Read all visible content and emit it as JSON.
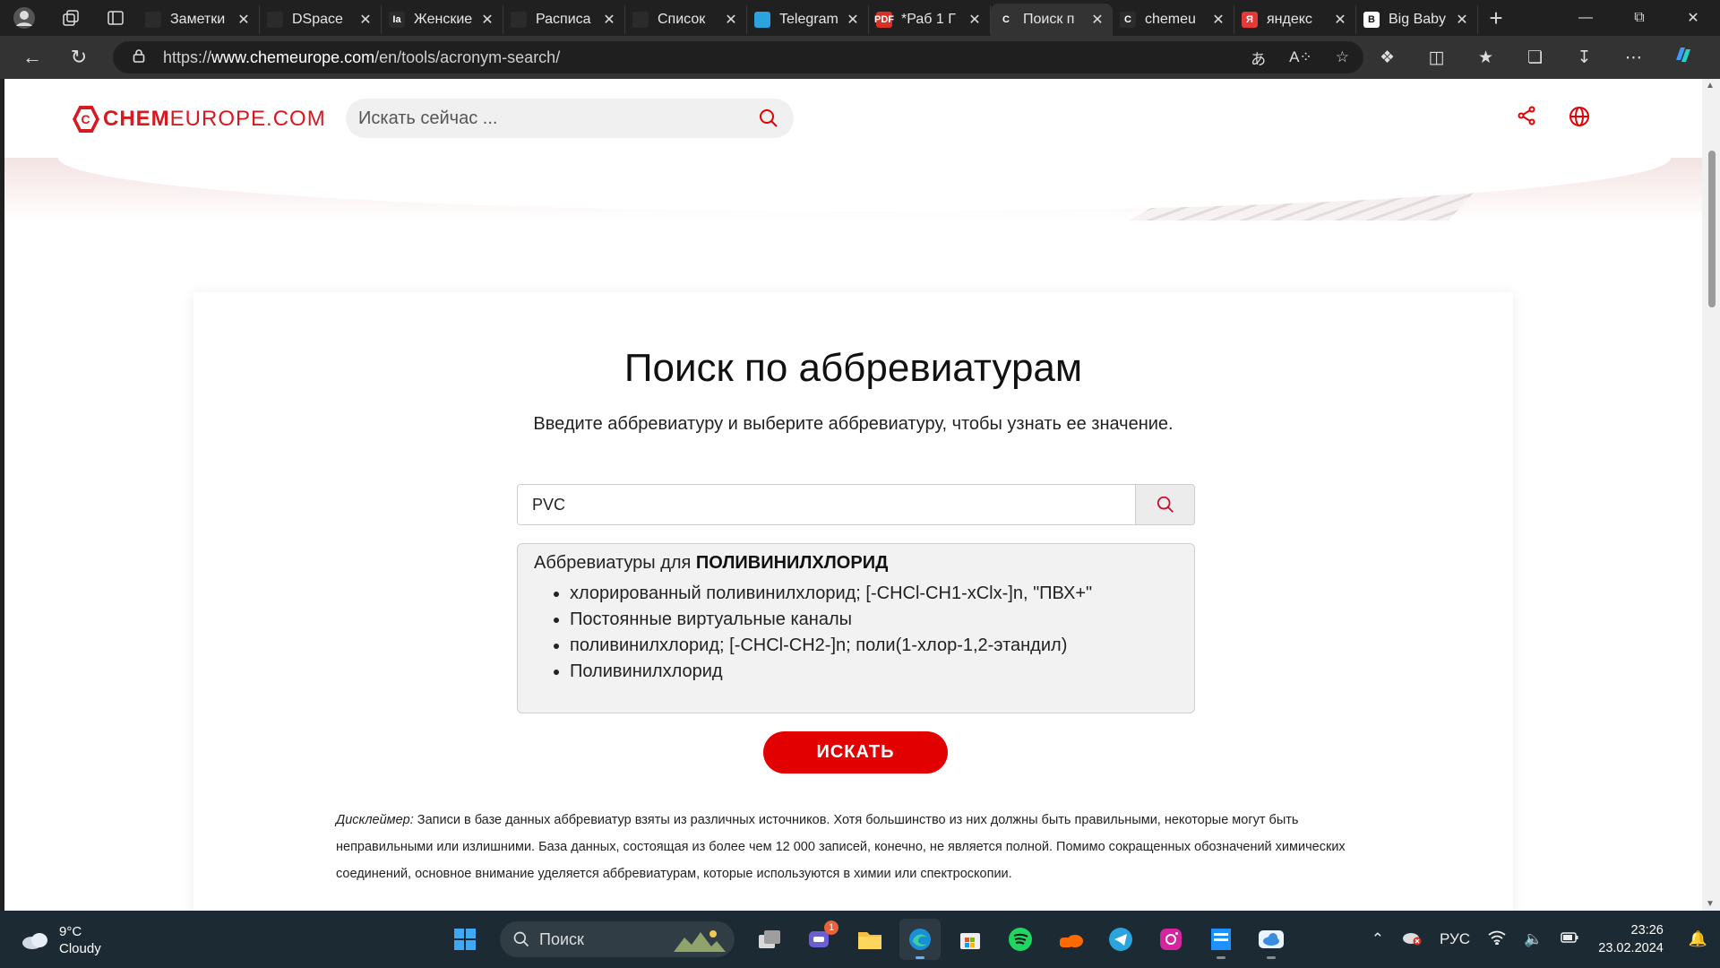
{
  "browser": {
    "tabs": [
      {
        "title": "Заметки",
        "fav_color": "#2b2b2b",
        "fav_glyph": ""
      },
      {
        "title": "DSpace",
        "fav_color": "#2b2b2b",
        "fav_glyph": ""
      },
      {
        "title": "Женские",
        "fav_color": "#2b2b2b",
        "fav_glyph": "Ia"
      },
      {
        "title": "Расписа",
        "fav_color": "#2b2b2b",
        "fav_glyph": ""
      },
      {
        "title": "Список",
        "fav_color": "#2b2b2b",
        "fav_glyph": ""
      },
      {
        "title": "Telegram",
        "fav_color": "#2aa3df",
        "fav_glyph": ""
      },
      {
        "title": "*Раб 1 Г",
        "fav_color": "#d93025",
        "fav_glyph": "PDF"
      },
      {
        "title": "Поиск п",
        "fav_color": "#333333",
        "fav_glyph": "C",
        "active": true
      },
      {
        "title": "chemeu",
        "fav_color": "#2b2b2b",
        "fav_glyph": "C"
      },
      {
        "title": "яндекс",
        "fav_color": "#e53935",
        "fav_glyph": "Я"
      },
      {
        "title": "Big Baby",
        "fav_color": "#ffffff",
        "fav_glyph": "B"
      }
    ],
    "url_prefix": "https://",
    "url_host": "www.chemeurope.com",
    "url_path": "/en/tools/acronym-search/"
  },
  "site": {
    "logo_chem": "CHEM",
    "logo_europe": "EUROPE.COM",
    "search_placeholder": "Искать сейчас ...",
    "accent": "#e20000"
  },
  "main": {
    "title": "Поиск по аббревиатурам",
    "subtitle": "Введите аббревиатуру и выберите аббревиатуру, чтобы узнать ее значение.",
    "query_value": "PVC",
    "result_heading_prefix": "Аббревиатуры для ",
    "result_heading_term": "ПОЛИВИНИЛХЛОРИД",
    "results": [
      "хлорированный поливинилхлорид; [-CHCl-CH1-xClx-]n, \"ПВХ+\"",
      "Постоянные виртуальные каналы",
      "поливинилхлорид; [-CHCl-CH2-]n; поли(1-хлор-1,2-этандил)",
      "Поливинилхлорид"
    ],
    "search_button": "ИСКАТЬ",
    "disclaimer_label": "Дисклеймер:",
    "disclaimer_text": " Записи в базе данных аббревиатур взяты из различных источников. Хотя большинство из них должны быть правильными, некоторые могут быть неправильными или излишними. База данных, состоящая из более чем 12 000 записей, конечно, не является полной. Помимо сокращенных обозначений химических соединений, основное внимание уделяется аббревиатурам, которые используются в химии или спектроскопии."
  },
  "taskbar": {
    "weather_temp": "9°C",
    "weather_desc": "Cloudy",
    "search_label": "Поиск",
    "teams_badge": "1",
    "lang": "РУС",
    "time": "23:26",
    "date": "23.02.2024"
  }
}
